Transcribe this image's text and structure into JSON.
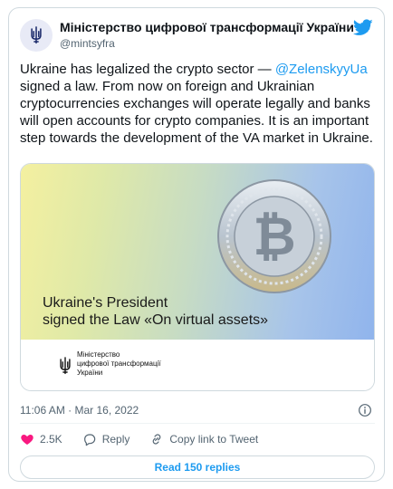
{
  "author": {
    "display_name": "Міністерство цифрової трансформації України",
    "handle": "@mintsyfra"
  },
  "tweet": {
    "text_before": "Ukraine has legalized the crypto sector — ",
    "mention": "@ZelenskyyUa",
    "text_after": " signed a law. From now on foreign and Ukrainian cryptocurrencies exchanges will operate legally and banks will open accounts for crypto companies. It is an important step towards the development of the VA market in Ukraine."
  },
  "media": {
    "headline": "Ukraine's President\nsigned the Law «On virtual assets»",
    "org_name": "Міністерство\nцифрової трансформації\nУкраїни"
  },
  "meta": {
    "timestamp": "11:06 AM · Mar 16, 2022"
  },
  "actions": {
    "like_count": "2.5K",
    "reply_label": "Reply",
    "copy_label": "Copy link to Tweet"
  },
  "replies": {
    "label": "Read 150 replies"
  },
  "colors": {
    "accent": "#1d9bf0",
    "like": "#f91880",
    "border": "#cfd9de"
  },
  "icons": [
    "trident-icon",
    "verified-icon",
    "twitter-bird-icon",
    "bitcoin-coin-icon",
    "info-icon",
    "heart-icon",
    "reply-icon",
    "link-icon"
  ]
}
